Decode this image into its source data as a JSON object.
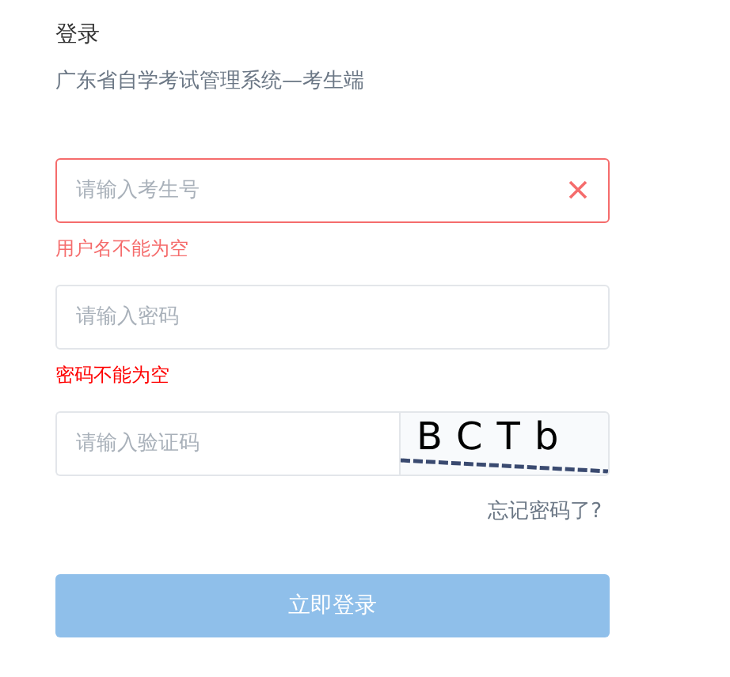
{
  "title": "登录",
  "subtitle": "广东省自学考试管理系统—考生端",
  "fields": [
    {
      "kind": "text",
      "placeholder": "请输入考生号",
      "error": true,
      "message": {
        "text": "用户名不能为空",
        "color": "#f56c6c"
      }
    },
    {
      "kind": "password",
      "placeholder": "请输入密码",
      "error": false,
      "message": {
        "text": "密码不能为空",
        "color": "#ff0000"
      }
    },
    {
      "kind": "captcha",
      "placeholder": "请输入验证码",
      "error": false,
      "captcha": "BCTb"
    }
  ],
  "forgot_link": "忘记密码了?",
  "submit": {
    "label": "立即登录",
    "disabled": true
  }
}
